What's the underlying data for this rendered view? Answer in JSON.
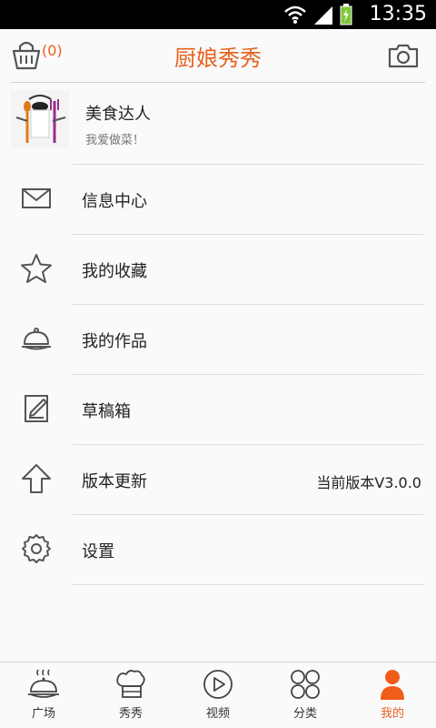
{
  "status_bar": {
    "time": "13:35",
    "icons": [
      "wifi-icon",
      "signal-icon",
      "battery-icon"
    ]
  },
  "header": {
    "title": "厨娘秀秀",
    "cart_count": "(0)",
    "accent_color": "#e8611f"
  },
  "profile": {
    "name": "美食达人",
    "signature": "我爱做菜！"
  },
  "menu": {
    "items": [
      {
        "label": "信息中心",
        "icon": "mail-icon"
      },
      {
        "label": "我的收藏",
        "icon": "star-icon"
      },
      {
        "label": "我的作品",
        "icon": "dish-icon"
      },
      {
        "label": "草稿箱",
        "icon": "draft-icon"
      },
      {
        "label": "版本更新",
        "icon": "upload-icon",
        "value": "当前版本V3.0.0"
      },
      {
        "label": "设置",
        "icon": "gear-icon"
      }
    ]
  },
  "tabbar": {
    "items": [
      {
        "label": "广场",
        "icon": "plaza-icon"
      },
      {
        "label": "秀秀",
        "icon": "chef-hat-icon"
      },
      {
        "label": "视频",
        "icon": "play-icon"
      },
      {
        "label": "分类",
        "icon": "category-icon"
      },
      {
        "label": "我的",
        "icon": "person-icon",
        "active": true
      }
    ]
  }
}
